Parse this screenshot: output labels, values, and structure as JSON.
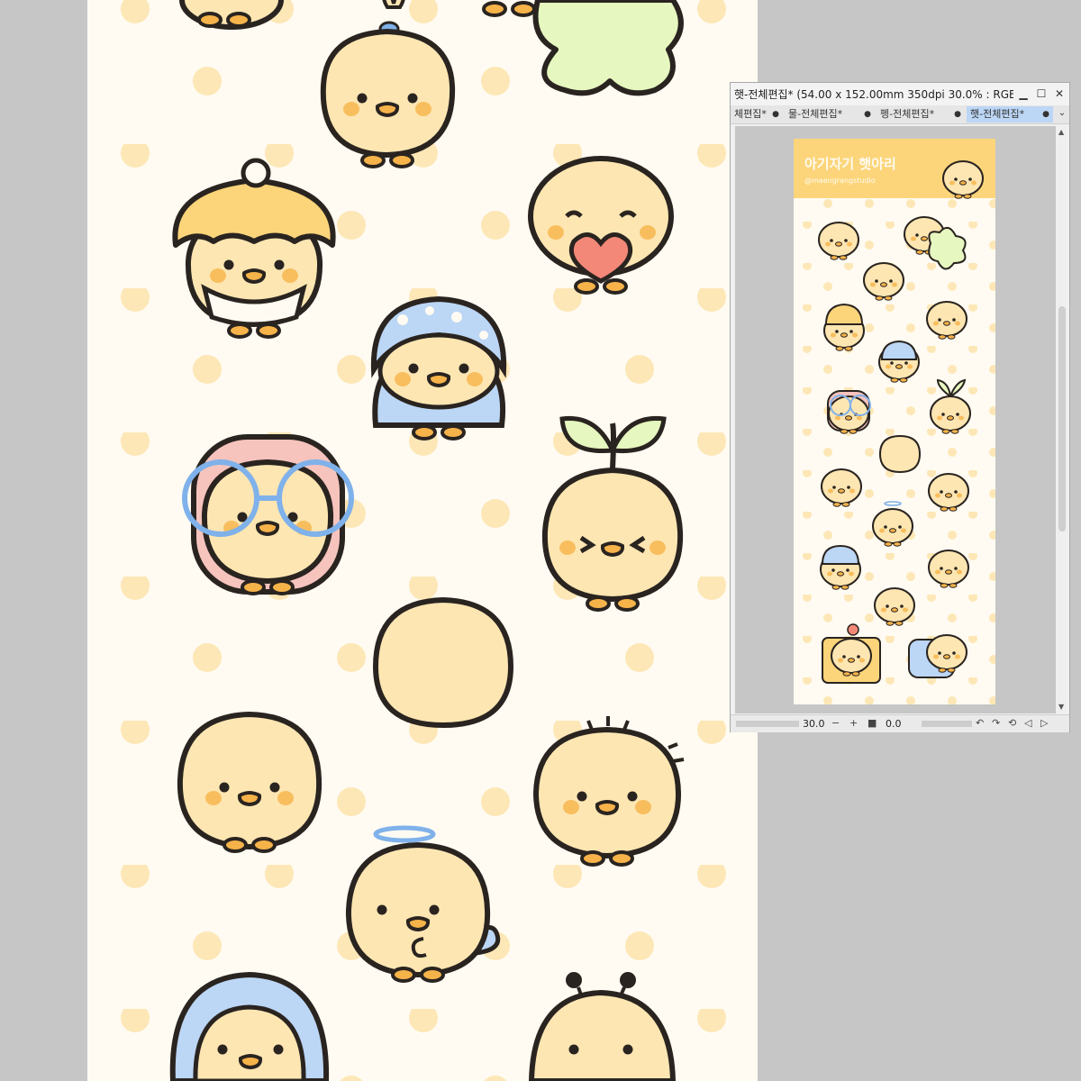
{
  "window": {
    "title": "햇-전체편집* (54.00 x 152.00mm 350dpi 30.0% : RGB:sR",
    "minimize_icon": "minimize-icon",
    "maximize_icon": "maximize-icon",
    "close_icon": "close-icon"
  },
  "tabs": [
    {
      "label": "체편집*",
      "modified": "●"
    },
    {
      "label": "물-전체편집*",
      "modified": "●"
    },
    {
      "label": "펭-전체편집*",
      "modified": "●"
    },
    {
      "label": "햇-전체편집*",
      "modified": "●"
    }
  ],
  "tab_menu_icon": "chevron-down-icon",
  "preview": {
    "header_title": "아기자기 햇아리",
    "header_subtitle": "@maengrangstudio"
  },
  "status": {
    "zoom": "30.0",
    "rotation": "0.0"
  },
  "colors": {
    "background": "#c6c6c6",
    "paper": "#fffbf2",
    "dots": "#fde7b6",
    "chick": "#fde6b2",
    "outline": "#2a2420",
    "blush": "#f8be5e",
    "beak": "#f6b34a",
    "blue": "#7fb1ea",
    "blue_light": "#bcd6f5",
    "pink": "#f6c3bd",
    "heart": "#f38878",
    "leaf": "#e6f7bf",
    "hat": "#fcd57a",
    "header": "#fcd57a",
    "active_tab": "#bcd6f5"
  }
}
